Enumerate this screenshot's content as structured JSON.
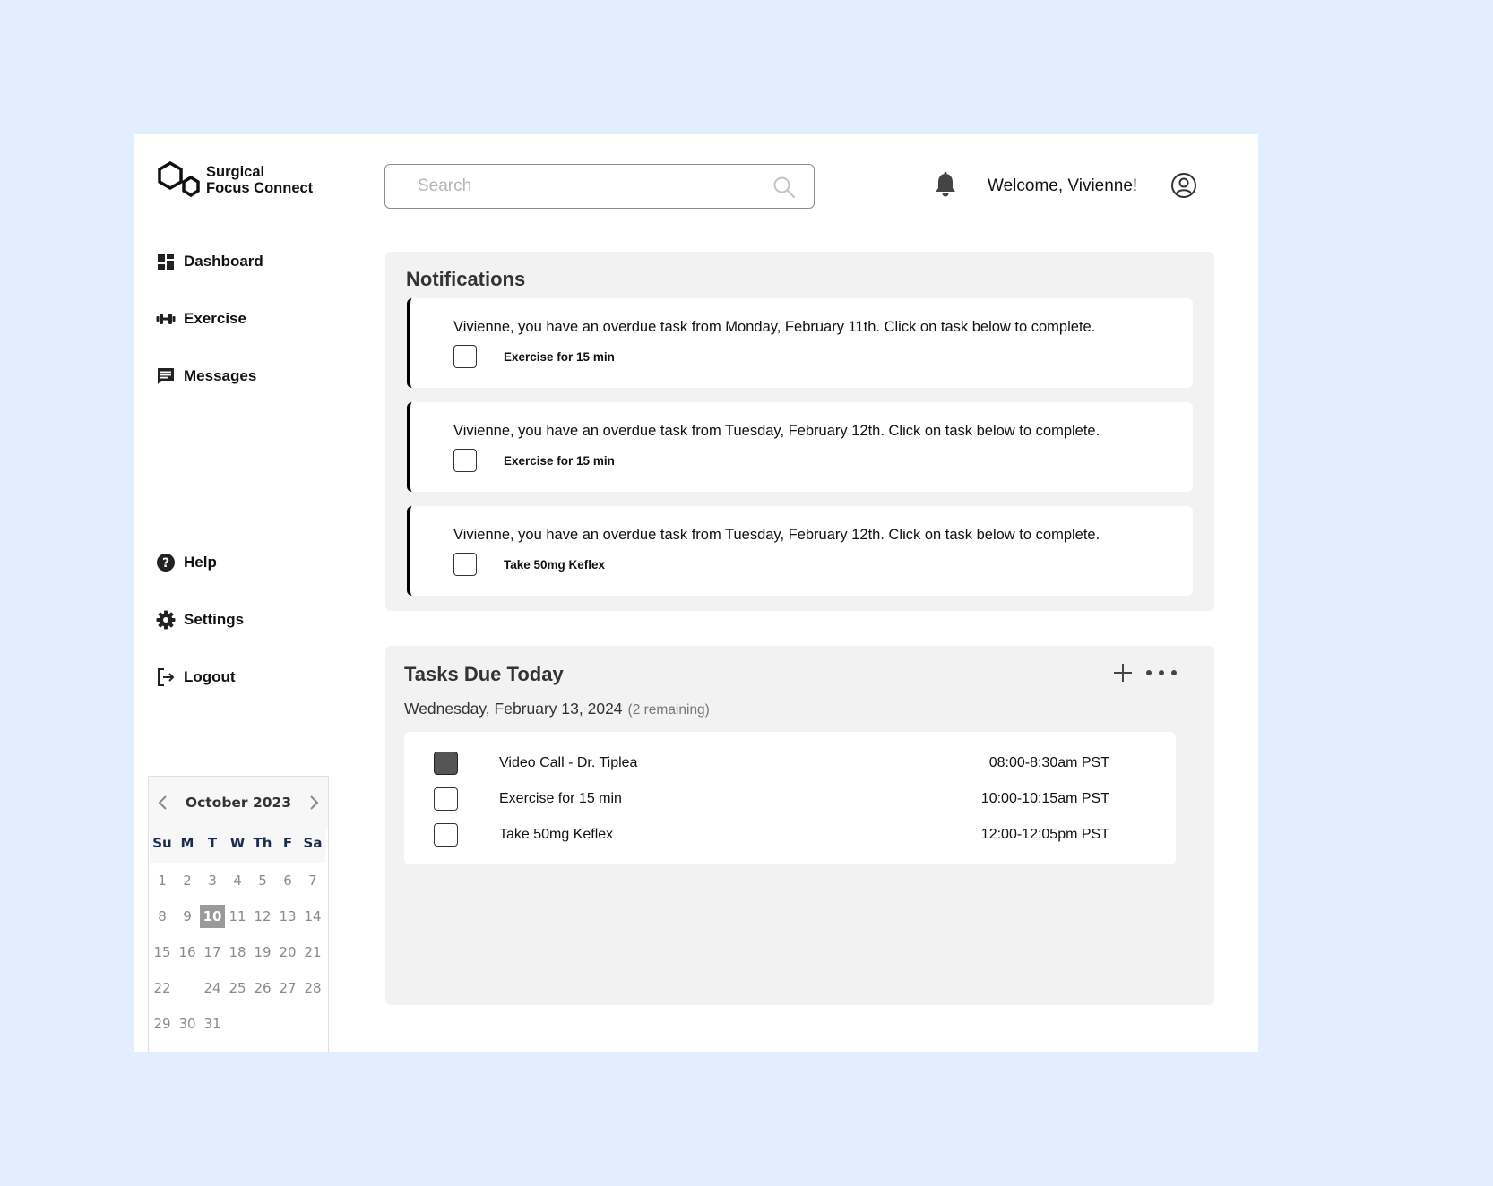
{
  "app": {
    "logo_line1": "Surgical",
    "logo_line2": "Focus Connect",
    "search_placeholder": "Search",
    "welcome": "Welcome, Vivienne!"
  },
  "sidebar": {
    "items": [
      {
        "label": "Dashboard",
        "icon": "dashboard-icon"
      },
      {
        "label": "Exercise",
        "icon": "dumbbell-icon"
      },
      {
        "label": "Messages",
        "icon": "message-icon"
      }
    ],
    "bottom_items": [
      {
        "label": "Help",
        "icon": "help-icon"
      },
      {
        "label": "Settings",
        "icon": "gear-icon"
      },
      {
        "label": "Logout",
        "icon": "logout-icon"
      }
    ]
  },
  "calendar": {
    "title": "October 2023",
    "weekdays": [
      "Su",
      "M",
      "T",
      "W",
      "Th",
      "F",
      "Sa"
    ],
    "days": [
      "1",
      "2",
      "3",
      "4",
      "5",
      "6",
      "7",
      "8",
      "9",
      "10",
      "11",
      "12",
      "13",
      "14",
      "15",
      "16",
      "17",
      "18",
      "19",
      "20",
      "21",
      "22",
      "",
      "24",
      "25",
      "26",
      "27",
      "28",
      "29",
      "30",
      "31"
    ],
    "selected": "10"
  },
  "notifications": {
    "title": "Notifications",
    "items": [
      {
        "text": "Vivienne, you have an overdue task from Monday, February 11th. Click on task below to complete.",
        "task": "Exercise for 15 min"
      },
      {
        "text": "Vivienne, you have an overdue task from Tuesday, February 12th. Click on task below to complete.",
        "task": "Exercise for 15 min"
      },
      {
        "text": "Vivienne, you have an overdue task from Tuesday, February 12th. Click on task below to complete.",
        "task": "Take 50mg Keflex"
      }
    ]
  },
  "tasks": {
    "title": "Tasks Due Today",
    "date": "Wednesday, February 13, 2024",
    "remaining": "(2 remaining)",
    "items": [
      {
        "name": "Video Call - Dr. Tiplea",
        "time": "08:00-8:30am PST",
        "checked": true
      },
      {
        "name": "Exercise for 15 min",
        "time": "10:00-10:15am PST",
        "checked": false
      },
      {
        "name": "Take 50mg Keflex",
        "time": "12:00-12:05pm PST",
        "checked": false
      }
    ]
  },
  "colors": {
    "background": "#e2eefd",
    "panel": "#f2f2f2",
    "accent": "#000000"
  }
}
